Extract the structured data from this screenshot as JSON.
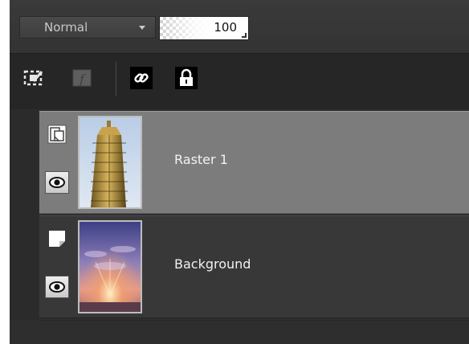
{
  "toolbar": {
    "blend_mode": "Normal",
    "opacity_value": "100"
  },
  "tools": [
    {
      "icon": "new-mask-layer-icon"
    },
    {
      "icon": "effects-fx-icon"
    },
    {
      "icon": "link-icon"
    },
    {
      "icon": "lock-icon"
    }
  ],
  "layers": [
    {
      "name": "Raster 1",
      "selected": true,
      "icon": "raster-layer-icon",
      "thumbnail": "tower-building-image"
    },
    {
      "name": "Background",
      "selected": false,
      "icon": "background-layer-icon",
      "thumbnail": "sunset-sky-image"
    }
  ],
  "colors": {
    "panel_bg": "#2c2c2c",
    "selected_layer": "#7c7c7c",
    "layer_bg": "#383838",
    "text": "#f2f2f2"
  }
}
